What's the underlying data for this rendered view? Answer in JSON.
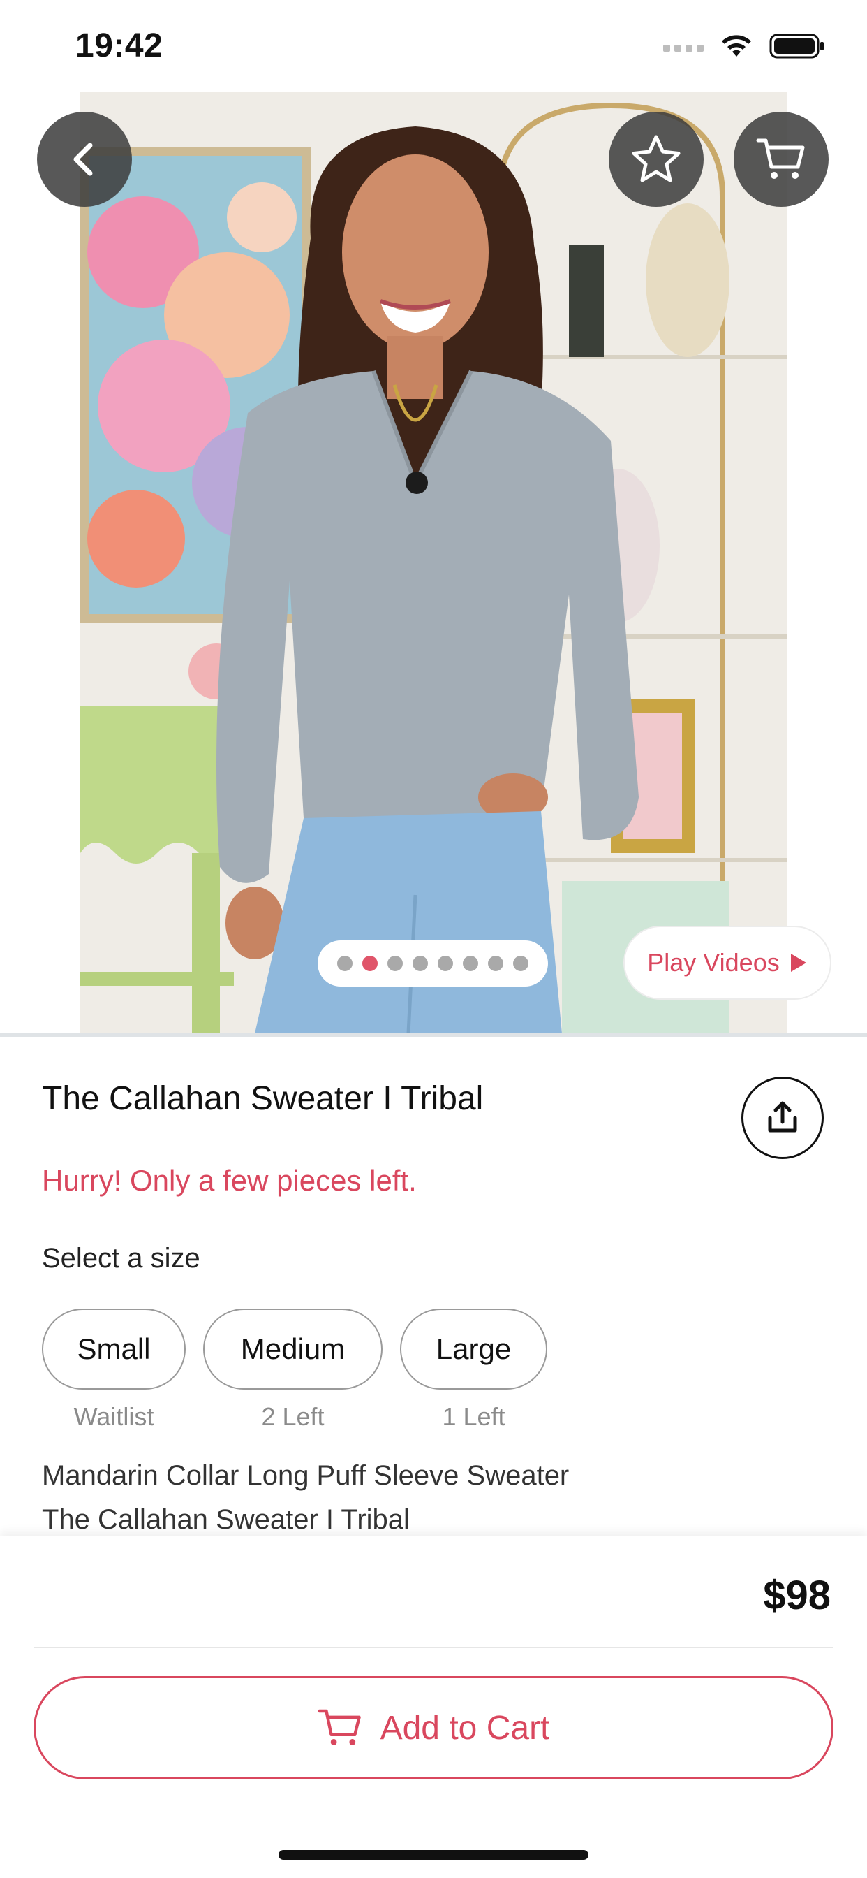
{
  "status_bar": {
    "time": "19:42"
  },
  "hero": {
    "image_count": 8,
    "active_index": 1,
    "play_videos_label": "Play Videos"
  },
  "product": {
    "title": "The Callahan Sweater I Tribal",
    "urgency_text": "Hurry! Only a few pieces left.",
    "select_size_label": "Select a size",
    "sizes": [
      {
        "label": "Small",
        "availability": "Waitlist"
      },
      {
        "label": "Medium",
        "availability": "2 Left"
      },
      {
        "label": "Large",
        "availability": "1 Left"
      }
    ],
    "description_lines": [
      "Mandarin Collar Long Puff Sleeve Sweater",
      "The Callahan Sweater I Tribal"
    ],
    "price": "$98"
  },
  "actions": {
    "add_to_cart_label": "Add to Cart"
  },
  "icons": {
    "back": "chevron-left-icon",
    "favorite": "star-icon",
    "cart": "shopping-cart-icon",
    "share": "share-icon",
    "play": "play-icon"
  },
  "colors": {
    "accent": "#d9475e",
    "button_dark": "#3c3c3c",
    "muted_text": "#8a8a8a"
  }
}
